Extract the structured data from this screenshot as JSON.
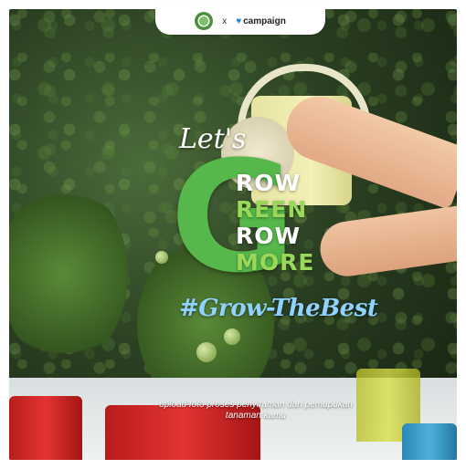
{
  "header": {
    "logo_icon": "grow-green-logo-icon",
    "separator": "x",
    "brand": "campaign",
    "brand_icon": "heart-icon"
  },
  "headline": {
    "lets": "Let's",
    "big_letter": "G",
    "lines": [
      {
        "text": "ROW",
        "color": "white"
      },
      {
        "text": "REEN",
        "color": "green"
      },
      {
        "text": "ROW",
        "color": "white"
      },
      {
        "text": "MORE",
        "color": "green"
      }
    ],
    "hashtag": "#Grow-TheBest"
  },
  "caption": "upload foto proses penyiraman dan pemupukan tanaman kamu",
  "colors": {
    "green": "#56b84a",
    "light_green": "#9ad85a",
    "hashtag_blue": "#8fd1ff",
    "brand_blue": "#1e88e5"
  }
}
